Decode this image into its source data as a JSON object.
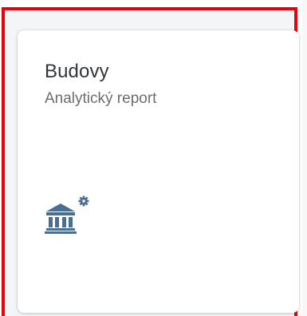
{
  "tile": {
    "title": "Budovy",
    "subtitle": "Analytický report",
    "icon": "building-settings-icon"
  },
  "colors": {
    "highlight": "#e8000b",
    "icon": "#4a6e8f",
    "title": "#32363a",
    "subtitle": "#6a6d70"
  }
}
